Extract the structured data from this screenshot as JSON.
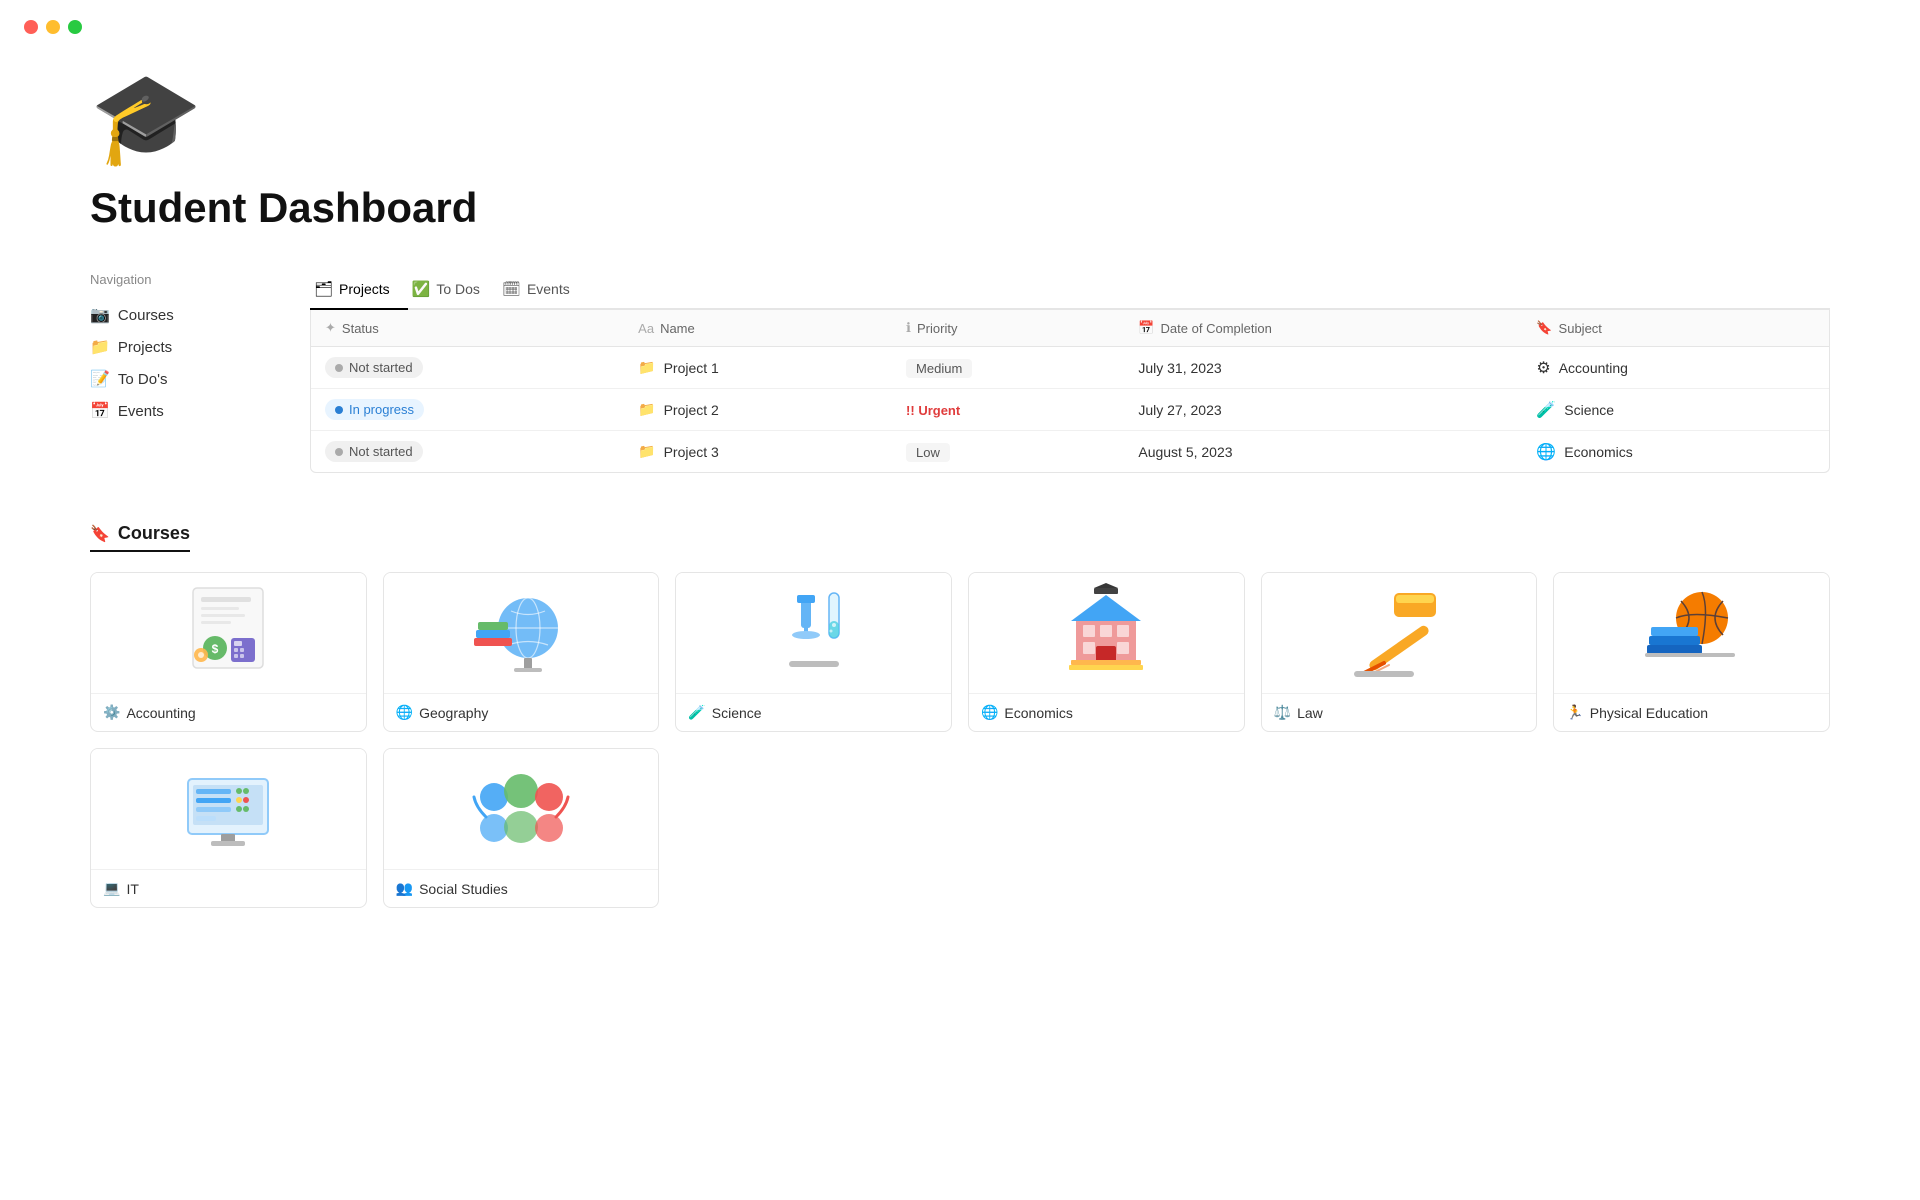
{
  "window": {
    "title": "Student Dashboard"
  },
  "traffic_lights": {
    "red": "#ff5f57",
    "yellow": "#ffbd2e",
    "green": "#28ca41"
  },
  "page": {
    "icon": "🎓",
    "title": "Student Dashboard"
  },
  "sidebar": {
    "label": "Navigation",
    "items": [
      {
        "id": "courses",
        "icon": "📷",
        "label": "Courses"
      },
      {
        "id": "projects",
        "icon": "📁",
        "label": "Projects"
      },
      {
        "id": "todos",
        "icon": "📝",
        "label": "To Do's"
      },
      {
        "id": "events",
        "icon": "📅",
        "label": "Events"
      }
    ]
  },
  "tabs": [
    {
      "id": "projects",
      "icon": "🗂",
      "label": "Projects",
      "active": true
    },
    {
      "id": "todos",
      "icon": "✅",
      "label": "To Dos",
      "active": false
    },
    {
      "id": "events",
      "icon": "🗓",
      "label": "Events",
      "active": false
    }
  ],
  "table": {
    "columns": [
      {
        "id": "status",
        "icon": "✦",
        "label": "Status"
      },
      {
        "id": "name",
        "icon": "Aa",
        "label": "Name"
      },
      {
        "id": "priority",
        "icon": "ℹ",
        "label": "Priority"
      },
      {
        "id": "date",
        "icon": "📅",
        "label": "Date of Completion"
      },
      {
        "id": "subject",
        "icon": "🔖",
        "label": "Subject"
      }
    ],
    "rows": [
      {
        "status": "Not started",
        "status_type": "gray",
        "name": "Project 1",
        "priority": "Medium",
        "priority_type": "medium",
        "date": "July 31, 2023",
        "subject": "Accounting",
        "subject_icon": "⚙"
      },
      {
        "status": "In progress",
        "status_type": "blue",
        "name": "Project 2",
        "priority": "!! Urgent",
        "priority_type": "urgent",
        "date": "July 27, 2023",
        "subject": "Science",
        "subject_icon": "🧪"
      },
      {
        "status": "Not started",
        "status_type": "gray",
        "name": "Project 3",
        "priority": "Low",
        "priority_type": "low",
        "date": "August 5, 2023",
        "subject": "Economics",
        "subject_icon": "🌐"
      }
    ]
  },
  "courses": {
    "section_label": "Courses",
    "cards": [
      {
        "id": "accounting",
        "label": "Accounting",
        "icon": "⚙",
        "color": "#7c6fcd"
      },
      {
        "id": "geography",
        "label": "Geography",
        "icon": "🌐",
        "color": "#7c6fcd"
      },
      {
        "id": "science",
        "label": "Science",
        "icon": "🧪",
        "color": "#7c6fcd"
      },
      {
        "id": "economics",
        "label": "Economics",
        "icon": "🌐",
        "color": "#7c6fcd"
      },
      {
        "id": "law",
        "label": "Law",
        "icon": "⚖",
        "color": "#7c6fcd"
      },
      {
        "id": "pe",
        "label": "Physical Education",
        "icon": "🏃",
        "color": "#7c6fcd"
      }
    ],
    "cards_row2": [
      {
        "id": "it",
        "label": "IT",
        "icon": "💻",
        "color": "#7c6fcd"
      },
      {
        "id": "social",
        "label": "Social Studies",
        "icon": "👥",
        "color": "#7c6fcd"
      }
    ]
  }
}
